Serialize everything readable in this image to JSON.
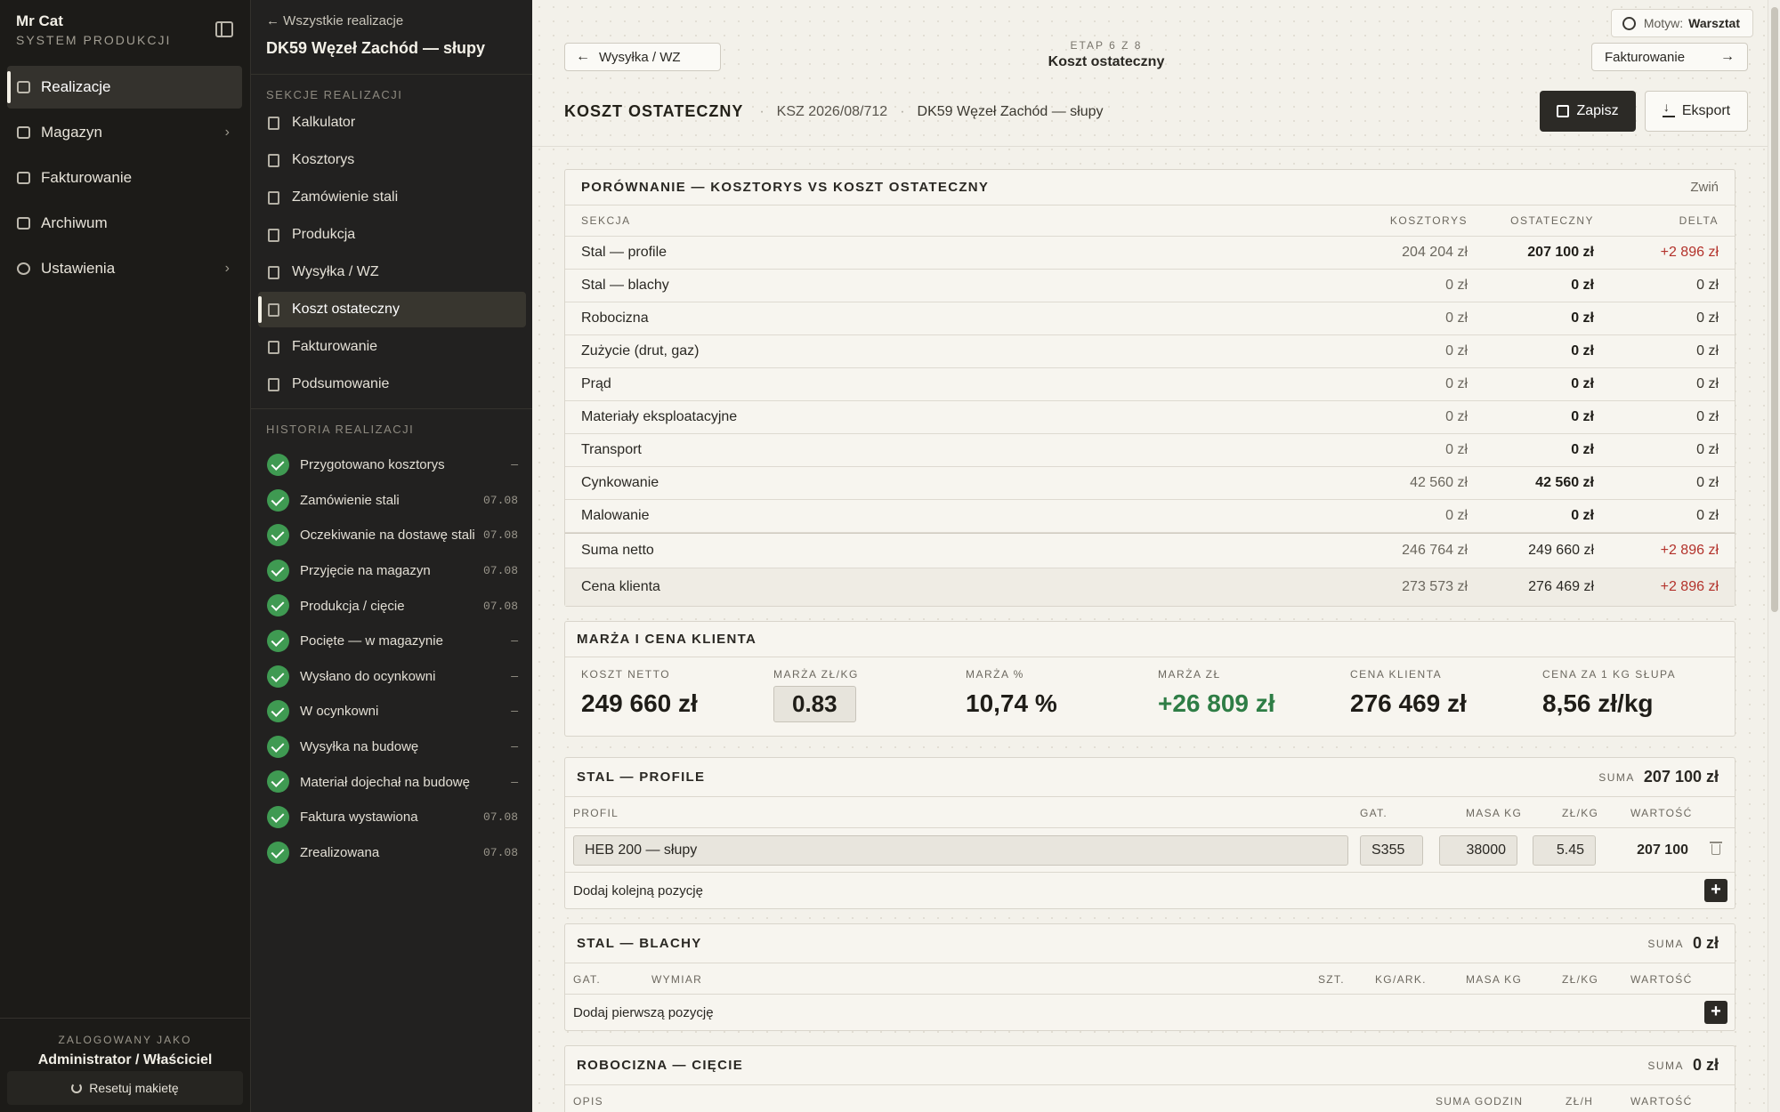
{
  "nav": {
    "brand_name": "Mr Cat",
    "brand_sub": "SYSTEM PRODUKCJI",
    "items": [
      {
        "label": "Realizacje",
        "icon": "list-check-icon"
      },
      {
        "label": "Magazyn",
        "icon": "box-icon"
      },
      {
        "label": "Fakturowanie",
        "icon": "document-icon"
      },
      {
        "label": "Archiwum",
        "icon": "archive-icon"
      },
      {
        "label": "Ustawienia",
        "icon": "gear-icon"
      }
    ],
    "logged_label": "ZALOGOWANY JAKO",
    "user": "Administrator / Właściciel",
    "reset_label": "Resetuj makietę"
  },
  "panel": {
    "back_label": "Wszystkie realizacje",
    "title": "DK59 Węzeł Zachód — słupy",
    "sections_label": "SEKCJE REALIZACJI",
    "sections": [
      "Kalkulator",
      "Kosztorys",
      "Zamówienie stali",
      "Produkcja",
      "Wysyłka / WZ",
      "Koszt ostateczny",
      "Fakturowanie",
      "Podsumowanie"
    ],
    "active_section": "Koszt ostateczny",
    "history_label": "HISTORIA REALIZACJI",
    "history": [
      {
        "label": "Przygotowano kosztorys",
        "date": "—"
      },
      {
        "label": "Zamówienie stali",
        "date": "07.08"
      },
      {
        "label": "Oczekiwanie na dostawę stali",
        "date": "07.08"
      },
      {
        "label": "Przyjęcie na magazyn",
        "date": "07.08"
      },
      {
        "label": "Produkcja / cięcie",
        "date": "07.08"
      },
      {
        "label": "Pocięte — w magazynie",
        "date": "—"
      },
      {
        "label": "Wysłano do ocynkowni",
        "date": "—"
      },
      {
        "label": "W ocynkowni",
        "date": "—"
      },
      {
        "label": "Wysyłka na budowę",
        "date": "—"
      },
      {
        "label": "Materiał dojechał na budowę",
        "date": "—"
      },
      {
        "label": "Faktura wystawiona",
        "date": "07.08"
      },
      {
        "label": "Zrealizowana",
        "date": "07.08"
      }
    ]
  },
  "main": {
    "theme_label": "Motyw:",
    "theme_value": "Warsztat",
    "prev_step": "Wysyłka / WZ",
    "next_step": "Fakturowanie",
    "step_num": "ETAP 6 Z 8",
    "step_title": "Koszt ostateczny",
    "page_title": "KOSZT OSTATECZNY",
    "doc_no": "KSZ 2026/08/712",
    "project": "DK59 Węzeł Zachód — słupy",
    "save_label": "Zapisz",
    "export_label": "Eksport"
  },
  "comparison": {
    "title": "PORÓWNANIE — KOSZTORYS VS KOSZT OSTATECZNY",
    "collapse_label": "Zwiń",
    "headers": {
      "section": "SEKCJA",
      "est": "KOSZTORYS",
      "final": "OSTATECZNY",
      "delta": "DELTA"
    },
    "rows": [
      {
        "name": "Stal — profile",
        "est": "204 204 zł",
        "final": "207 100 zł",
        "delta": "+2 896 zł",
        "pos": true
      },
      {
        "name": "Stal — blachy",
        "est": "0 zł",
        "final": "0 zł",
        "delta": "0 zł",
        "pos": false
      },
      {
        "name": "Robocizna",
        "est": "0 zł",
        "final": "0 zł",
        "delta": "0 zł",
        "pos": false
      },
      {
        "name": "Zużycie (drut, gaz)",
        "est": "0 zł",
        "final": "0 zł",
        "delta": "0 zł",
        "pos": false
      },
      {
        "name": "Prąd",
        "est": "0 zł",
        "final": "0 zł",
        "delta": "0 zł",
        "pos": false
      },
      {
        "name": "Materiały eksploatacyjne",
        "est": "0 zł",
        "final": "0 zł",
        "delta": "0 zł",
        "pos": false
      },
      {
        "name": "Transport",
        "est": "0 zł",
        "final": "0 zł",
        "delta": "0 zł",
        "pos": false
      },
      {
        "name": "Cynkowanie",
        "est": "42 560 zł",
        "final": "42 560 zł",
        "delta": "0 zł",
        "pos": false
      },
      {
        "name": "Malowanie",
        "est": "0 zł",
        "final": "0 zł",
        "delta": "0 zł",
        "pos": false
      }
    ],
    "sum": {
      "name": "Suma netto",
      "est": "246 764 zł",
      "final": "249 660 zł",
      "delta": "+2 896 zł"
    },
    "client": {
      "name": "Cena klienta",
      "est": "273 573 zł",
      "final": "276 469 zł",
      "delta": "+2 896 zł"
    }
  },
  "margin": {
    "title": "MARŻA I CENA KLIENTA",
    "kpis": [
      {
        "label": "KOSZT NETTO",
        "value": "249 660 zł"
      },
      {
        "label": "MARŻA ZŁ/KG",
        "value": "0.83"
      },
      {
        "label": "MARŻA %",
        "value": "10,74 %"
      },
      {
        "label": "MARŻA ZŁ",
        "value": "+26 809 zł"
      },
      {
        "label": "CENA KLIENTA",
        "value": "276 469 zł"
      },
      {
        "label": "CENA ZA 1 KG SŁUPA",
        "value": "8,56 zł/kg"
      }
    ]
  },
  "profiles": {
    "title": "STAL — PROFILE",
    "sum_label": "SUMA",
    "sum_value": "207 100 zł",
    "headers": {
      "profile": "PROFIL",
      "grade": "GAT.",
      "mass": "MASA KG",
      "price": "ZŁ/KG",
      "value": "WARTOŚĆ"
    },
    "row": {
      "profile": "HEB 200 — słupy",
      "grade": "S355",
      "mass": "38000",
      "price": "5.45",
      "value": "207 100"
    },
    "add_label": "Dodaj kolejną pozycję"
  },
  "plates": {
    "title": "STAL — BLACHY",
    "sum_label": "SUMA",
    "sum_value": "0 zł",
    "headers": {
      "grade": "GAT.",
      "dim": "WYMIAR",
      "qty": "SZT.",
      "kg_sheet": "KG/ARK.",
      "mass": "MASA KG",
      "price": "ZŁ/KG",
      "value": "WARTOŚĆ"
    },
    "add_label": "Dodaj pierwszą pozycję"
  },
  "labor": {
    "title": "ROBOCIZNA — CIĘCIE",
    "sum_label": "SUMA",
    "sum_value": "0 zł",
    "headers": {
      "desc": "OPIS",
      "hours": "SUMA GODZIN",
      "rate": "ZŁ/H",
      "value": "WARTOŚĆ"
    }
  }
}
